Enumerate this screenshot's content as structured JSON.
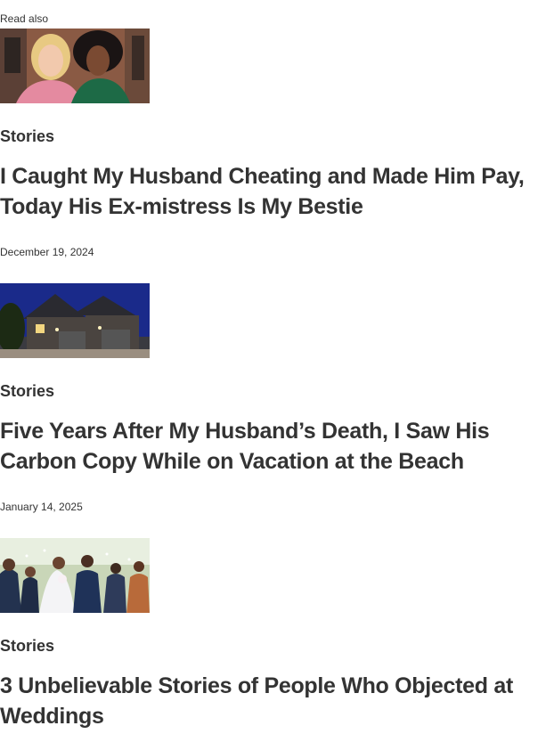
{
  "read_also_label": "Read also",
  "articles": [
    {
      "category": "Stories",
      "title": "I Caught My Husband Cheating and Made Him Pay, Today His Ex-mistress Is My Bestie",
      "date": "December 19, 2024"
    },
    {
      "category": "Stories",
      "title": "Five Years After My Husband’s Death, I Saw His Carbon Copy While on Vacation at the Beach",
      "date": "January 14, 2025"
    },
    {
      "category": "Stories",
      "title": "3 Unbelievable Stories of People Who Objected at Weddings"
    }
  ]
}
